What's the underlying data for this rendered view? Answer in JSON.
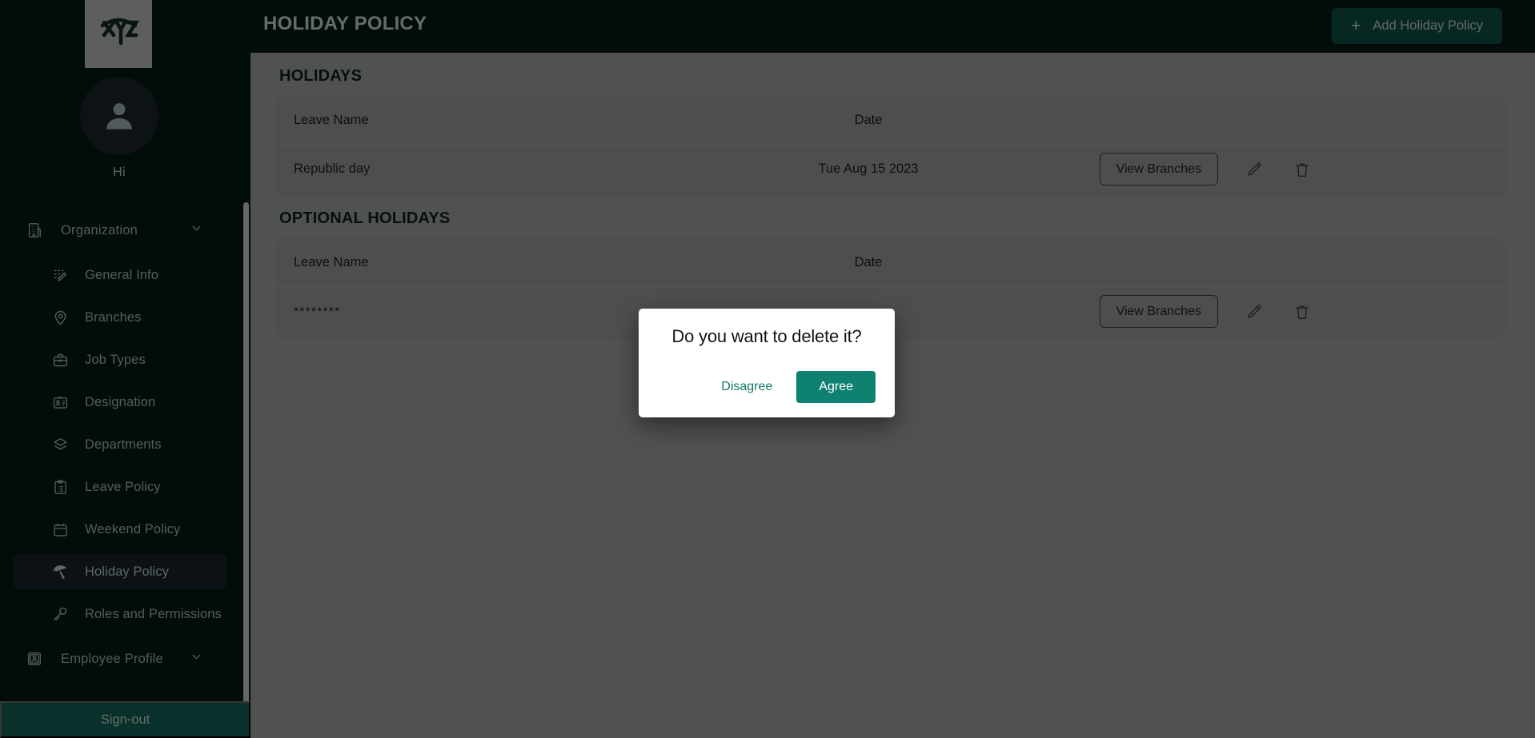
{
  "sidebar": {
    "logo_alt": "XYZ",
    "greeting": "Hi",
    "groups": [
      {
        "label": "Organization",
        "icon": "building-icon"
      },
      {
        "label": "Employee Profile",
        "icon": "employee-badge-icon"
      }
    ],
    "items": [
      {
        "label": "General Info",
        "icon": "grid-edit-icon"
      },
      {
        "label": "Branches",
        "icon": "map-pin-icon"
      },
      {
        "label": "Job Types",
        "icon": "briefcase-icon"
      },
      {
        "label": "Designation",
        "icon": "id-card-icon"
      },
      {
        "label": "Departments",
        "icon": "layers-icon"
      },
      {
        "label": "Leave Policy",
        "icon": "clipboard-list-icon"
      },
      {
        "label": "Weekend Policy",
        "icon": "calendar-icon"
      },
      {
        "label": "Holiday Policy",
        "icon": "umbrella-icon",
        "active": true
      },
      {
        "label": "Roles and Permissions",
        "icon": "key-icon"
      }
    ],
    "signout_label": "Sign-out"
  },
  "header": {
    "title": "HOLIDAY POLICY",
    "menu_icon": "hamburger-icon",
    "add_button": {
      "label": "Add Holiday Policy",
      "icon": "plus-icon"
    }
  },
  "main": {
    "sections": [
      {
        "title": "HOLIDAYS",
        "columns": {
          "name": "Leave Name",
          "date": "Date"
        },
        "rows": [
          {
            "name": "Republic day",
            "date": "Tue Aug 15 2023",
            "view_label": "View Branches",
            "edit_icon": "pencil-icon",
            "delete_icon": "trash-icon"
          }
        ]
      },
      {
        "title": "OPTIONAL HOLIDAYS",
        "columns": {
          "name": "Leave Name",
          "date": "Date"
        },
        "rows": [
          {
            "name": "********",
            "date": "",
            "view_label": "View Branches",
            "edit_icon": "pencil-icon",
            "delete_icon": "trash-icon"
          }
        ]
      }
    ]
  },
  "modal": {
    "title": "Do you want to delete it?",
    "disagree_label": "Disagree",
    "agree_label": "Agree"
  },
  "colors": {
    "sidebar_bg": "#04140f",
    "accent_green": "#0f8171",
    "signout_bg": "#104a42",
    "add_button_bg": "#0c3c37",
    "content_bg": "#7a7d7f",
    "card_bg": "#77797b"
  }
}
